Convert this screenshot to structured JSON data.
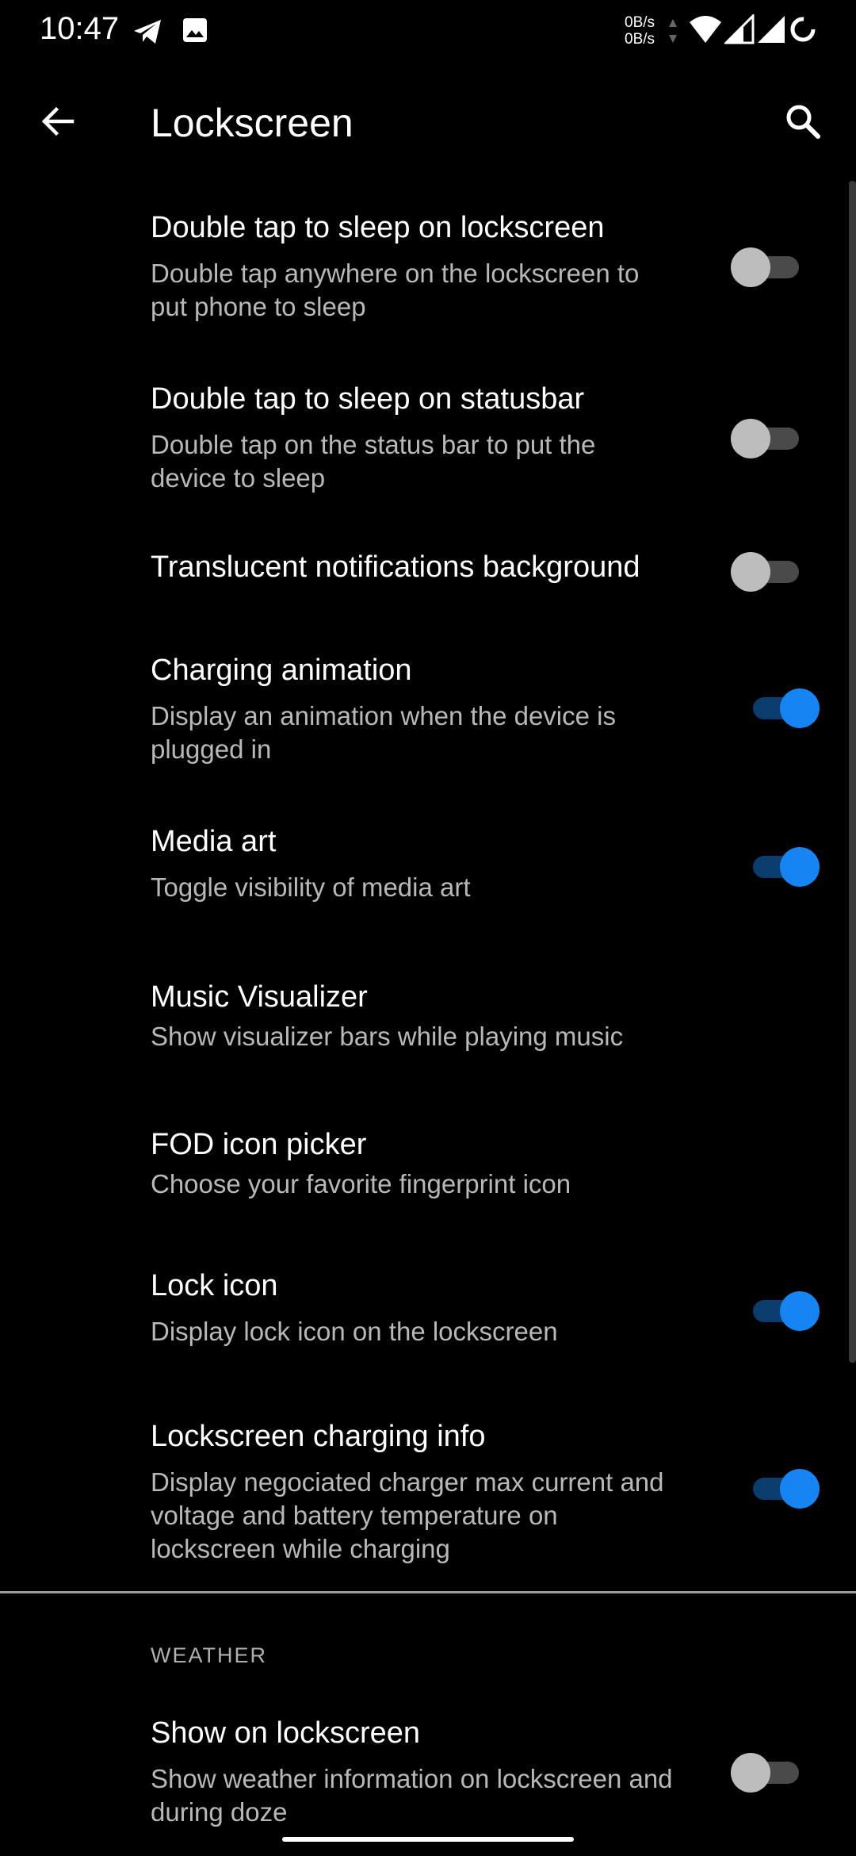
{
  "status_bar": {
    "time": "10:47",
    "netspeed_up": "0B/s",
    "netspeed_down": "0B/s",
    "icons": [
      "telegram-icon",
      "image-icon",
      "data-arrows-icon",
      "wifi-icon",
      "signal-icon",
      "signal-icon",
      "battery-ring-icon"
    ]
  },
  "app_bar": {
    "title": "Lockscreen",
    "back_icon": "arrow-back-icon",
    "search_icon": "search-icon"
  },
  "colors": {
    "background": "#000000",
    "accent": "#1684f2",
    "switch_off_thumb": "#bdbdbd",
    "summary_text": "#b8b8b8"
  },
  "settings": [
    {
      "title": "Double tap to sleep on lockscreen",
      "summary": "Double tap anywhere on the lockscreen to put phone to sleep",
      "switch": "off"
    },
    {
      "title": "Double tap to sleep on statusbar",
      "summary": "Double tap on the status bar to put the device to sleep",
      "switch": "off"
    },
    {
      "title": "Translucent notifications background",
      "summary": "",
      "switch": "off"
    },
    {
      "title": "Charging animation",
      "summary": "Display an animation when the device is plugged in",
      "switch": "on"
    },
    {
      "title": "Media art",
      "summary": "Toggle visibility of media art",
      "switch": "on"
    },
    {
      "title": "Music Visualizer",
      "summary": "Show visualizer bars while playing music",
      "switch": "none"
    },
    {
      "title": "FOD icon picker",
      "summary": "Choose your favorite fingerprint icon",
      "switch": "none"
    },
    {
      "title": "Lock icon",
      "summary": "Display lock icon on the lockscreen",
      "switch": "on"
    },
    {
      "title": "Lockscreen charging info",
      "summary": "Display negociated charger max current and voltage and battery temperature on lockscreen while charging",
      "switch": "on"
    }
  ],
  "weather_section": {
    "header": "WEATHER",
    "items": [
      {
        "title": "Show on lockscreen",
        "summary": "Show weather information on lockscreen and during doze",
        "switch": "off"
      }
    ]
  }
}
